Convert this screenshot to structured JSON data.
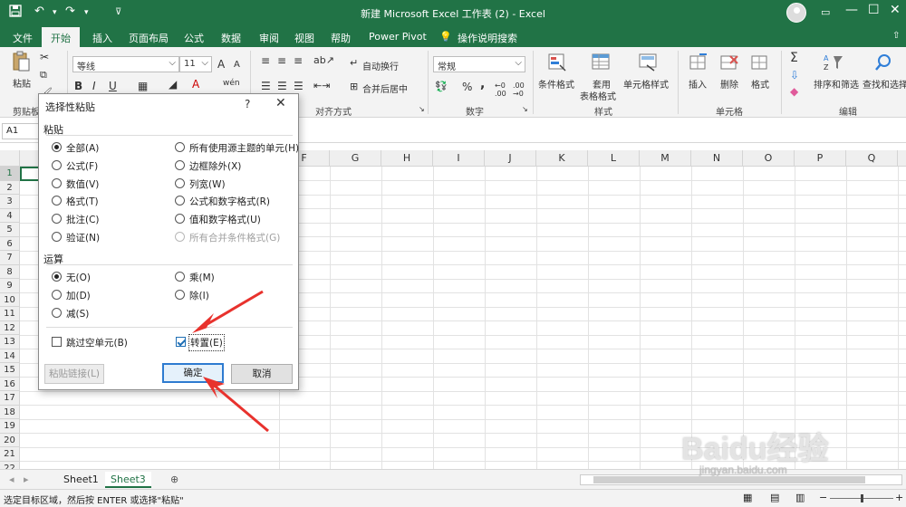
{
  "titlebar": {
    "title": "新建 Microsoft Excel 工作表 (2)  -  Excel",
    "minimize": "—",
    "maximize": "☐",
    "close": "✕"
  },
  "tabs": [
    "文件",
    "开始",
    "插入",
    "页面布局",
    "公式",
    "数据",
    "审阅",
    "视图",
    "帮助",
    "Power Pivot",
    "操作说明搜索"
  ],
  "ribbon": {
    "paste": "粘贴",
    "clipboard": "剪贴板",
    "font_name": "等线",
    "font_size": "11",
    "font_grow": "A",
    "font_shrink": "A",
    "bold": "B",
    "italic": "I",
    "underline": "U",
    "wrap_text": "自动换行",
    "merge_center": "合并后居中",
    "alignment_group": "对齐方式",
    "number_format": "常规",
    "percent": "%",
    "comma": ",",
    "number_group": "数字",
    "cond_format": "条件格式",
    "table_format_1": "套用",
    "table_format_2": "表格格式",
    "cell_style": "单元格样式",
    "styles_group": "样式",
    "insert": "插入",
    "delete": "删除",
    "format": "格式",
    "cells_group": "单元格",
    "sort_filter": "排序和筛选",
    "find_select": "查找和选择",
    "editing_group": "编辑"
  },
  "namebox": "A1",
  "columns": [
    "F",
    "G",
    "H",
    "I",
    "J",
    "K",
    "L",
    "M",
    "N",
    "O",
    "P",
    "Q"
  ],
  "rows": [
    "1",
    "2",
    "3",
    "4",
    "5",
    "6",
    "7",
    "8",
    "9",
    "10",
    "11",
    "12",
    "13",
    "14",
    "15",
    "16",
    "17",
    "18",
    "19",
    "20",
    "21",
    "22"
  ],
  "sheets": [
    "Sheet1",
    "Sheet3"
  ],
  "status": {
    "message": "选定目标区域，然后按 ENTER 或选择\"粘贴\""
  },
  "dialog": {
    "title": "选择性粘贴",
    "help": "?",
    "close": "✕",
    "paste_section": "粘贴",
    "paste_options_left": [
      "全部(A)",
      "公式(F)",
      "数值(V)",
      "格式(T)",
      "批注(C)",
      "验证(N)"
    ],
    "paste_options_right": [
      "所有使用源主题的单元(H)",
      "边框除外(X)",
      "列宽(W)",
      "公式和数字格式(R)",
      "值和数字格式(U)",
      "所有合并条件格式(G)"
    ],
    "operation_section": "运算",
    "operation_left": [
      "无(O)",
      "加(D)",
      "减(S)"
    ],
    "operation_right": [
      "乘(M)",
      "除(I)"
    ],
    "skip_blanks": "跳过空单元(B)",
    "transpose": "转置(E)",
    "paste_link": "粘贴链接(L)",
    "ok": "确定",
    "cancel": "取消"
  },
  "watermark": {
    "brand": "Baidu经验",
    "url": "jingyan.baidu.com"
  },
  "colors": {
    "excel_green": "#217346",
    "arrow_red": "#e8322d"
  }
}
